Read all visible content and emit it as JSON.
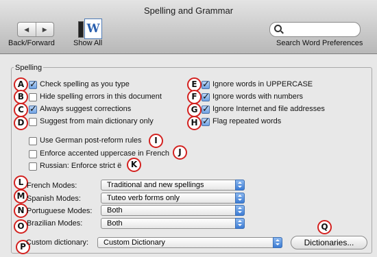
{
  "window": {
    "title": "Spelling and Grammar"
  },
  "toolbar": {
    "back_forward_label": "Back/Forward",
    "show_all_label": "Show All",
    "show_all_icon_letter": "W",
    "search_label": "Search Word Preferences",
    "search_value": ""
  },
  "spelling": {
    "section_label": "Spelling",
    "options": {
      "check_spelling": {
        "label": "Check spelling as you type",
        "checked": true,
        "marker": "A"
      },
      "hide_errors": {
        "label": "Hide spelling errors in this document",
        "checked": false,
        "marker": "B"
      },
      "always_suggest": {
        "label": "Always suggest corrections",
        "checked": true,
        "marker": "C"
      },
      "main_dictionary": {
        "label": "Suggest from main dictionary only",
        "checked": false,
        "marker": "D"
      },
      "ignore_uppercase": {
        "label": "Ignore words in UPPERCASE",
        "checked": true,
        "marker": "E"
      },
      "ignore_numbers": {
        "label": "Ignore words with numbers",
        "checked": true,
        "marker": "F"
      },
      "ignore_internet": {
        "label": "Ignore Internet and file addresses",
        "checked": true,
        "marker": "G"
      },
      "flag_repeated": {
        "label": "Flag repeated words",
        "checked": true,
        "marker": "H"
      },
      "german_rules": {
        "label": "Use German post-reform rules",
        "checked": false,
        "marker": "I"
      },
      "accented_french": {
        "label": "Enforce accented uppercase in French",
        "checked": false,
        "marker": "J"
      },
      "russian_strict": {
        "label": "Russian: Enforce strict ë",
        "checked": false,
        "marker": "K"
      }
    },
    "modes": {
      "french": {
        "label": "French Modes:",
        "value": "Traditional and new spellings",
        "marker": "L"
      },
      "spanish": {
        "label": "Spanish Modes:",
        "value": "Tuteo verb forms only",
        "marker": "M"
      },
      "portuguese": {
        "label": "Portuguese Modes:",
        "value": "Both",
        "marker": "N"
      },
      "brazilian": {
        "label": "Brazilian Modes:",
        "value": "Both",
        "marker": "O"
      }
    },
    "custom_dictionary": {
      "label": "Custom dictionary:",
      "value": "Custom Dictionary",
      "marker": "P"
    },
    "dictionaries_button": {
      "label": "Dictionaries...",
      "marker": "Q"
    }
  },
  "colors": {
    "marker_ring": "#d3211f",
    "checkbox_checked": "#6fa2e3",
    "popup_arrows": "#3b7bd3"
  }
}
